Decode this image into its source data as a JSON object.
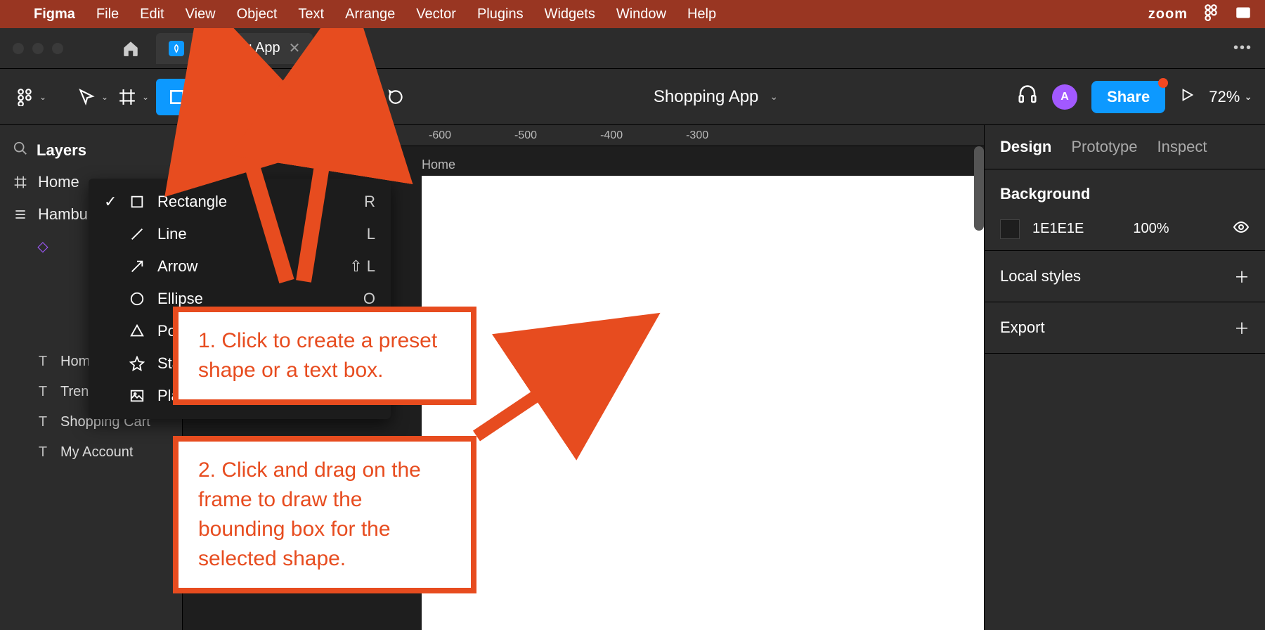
{
  "mac_menu": {
    "app": "Figma",
    "items": [
      "File",
      "Edit",
      "View",
      "Object",
      "Text",
      "Arrange",
      "Vector",
      "Plugins",
      "Widgets",
      "Window",
      "Help"
    ],
    "right": [
      "zoom"
    ]
  },
  "tab": {
    "title": "Shopping App"
  },
  "toolbar": {
    "page": "Shopping App",
    "share": "Share",
    "zoom": "72%",
    "avatar": "A"
  },
  "left_panel": {
    "title": "Layers",
    "frames": [
      "Home",
      "Hamburger"
    ],
    "diamond": "",
    "texts": [
      "Home",
      "Trending Items",
      "Shopping Cart",
      "My Account"
    ]
  },
  "ruler": [
    "-600",
    "-500",
    "-400",
    "-300"
  ],
  "canvas": {
    "frame": "Home"
  },
  "shape_menu": [
    {
      "label": "Rectangle",
      "shortcut": "R",
      "checked": true,
      "icon": "rect"
    },
    {
      "label": "Line",
      "shortcut": "L",
      "checked": false,
      "icon": "line"
    },
    {
      "label": "Arrow",
      "shortcut": "⇧ L",
      "checked": false,
      "icon": "arrow"
    },
    {
      "label": "Ellipse",
      "shortcut": "O",
      "checked": false,
      "icon": "ellipse"
    },
    {
      "label": "Polygon",
      "shortcut": "",
      "checked": false,
      "icon": "poly"
    },
    {
      "label": "Star",
      "shortcut": "",
      "checked": false,
      "icon": "star"
    },
    {
      "label": "Place image",
      "shortcut": "",
      "checked": false,
      "icon": "image"
    }
  ],
  "right_panel": {
    "tabs": [
      "Design",
      "Prototype",
      "Inspect"
    ],
    "background": {
      "label": "Background",
      "hex": "1E1E1E",
      "opacity": "100%"
    },
    "local_styles": "Local styles",
    "export": "Export"
  },
  "annotations": {
    "a1": "1. Click to create a preset shape or a text box.",
    "a2": "2. Click and drag on the frame to draw the bounding box for the selected shape."
  }
}
